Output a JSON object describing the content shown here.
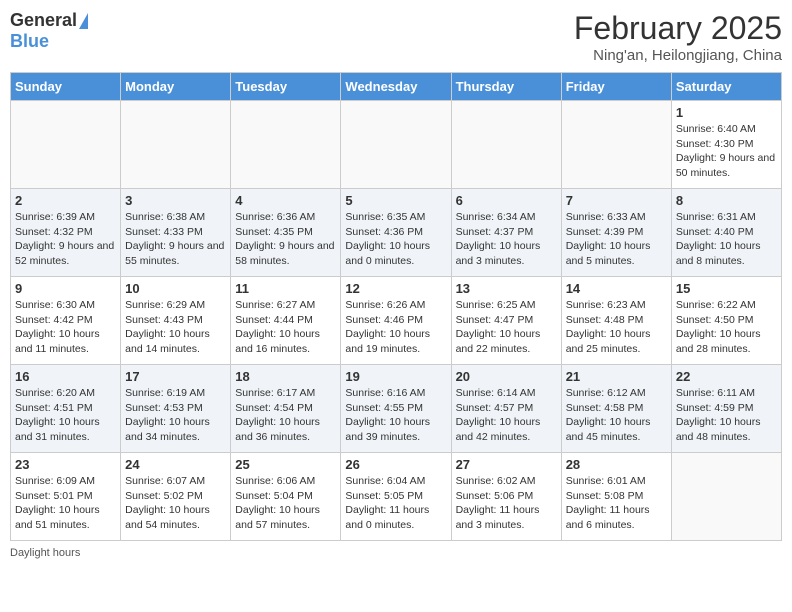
{
  "header": {
    "logo_general": "General",
    "logo_blue": "Blue",
    "month_year": "February 2025",
    "location": "Ning'an, Heilongjiang, China"
  },
  "weekdays": [
    "Sunday",
    "Monday",
    "Tuesday",
    "Wednesday",
    "Thursday",
    "Friday",
    "Saturday"
  ],
  "weeks": [
    [
      {
        "day": "",
        "info": ""
      },
      {
        "day": "",
        "info": ""
      },
      {
        "day": "",
        "info": ""
      },
      {
        "day": "",
        "info": ""
      },
      {
        "day": "",
        "info": ""
      },
      {
        "day": "",
        "info": ""
      },
      {
        "day": "1",
        "info": "Sunrise: 6:40 AM\nSunset: 4:30 PM\nDaylight: 9 hours and 50 minutes."
      }
    ],
    [
      {
        "day": "2",
        "info": "Sunrise: 6:39 AM\nSunset: 4:32 PM\nDaylight: 9 hours and 52 minutes."
      },
      {
        "day": "3",
        "info": "Sunrise: 6:38 AM\nSunset: 4:33 PM\nDaylight: 9 hours and 55 minutes."
      },
      {
        "day": "4",
        "info": "Sunrise: 6:36 AM\nSunset: 4:35 PM\nDaylight: 9 hours and 58 minutes."
      },
      {
        "day": "5",
        "info": "Sunrise: 6:35 AM\nSunset: 4:36 PM\nDaylight: 10 hours and 0 minutes."
      },
      {
        "day": "6",
        "info": "Sunrise: 6:34 AM\nSunset: 4:37 PM\nDaylight: 10 hours and 3 minutes."
      },
      {
        "day": "7",
        "info": "Sunrise: 6:33 AM\nSunset: 4:39 PM\nDaylight: 10 hours and 5 minutes."
      },
      {
        "day": "8",
        "info": "Sunrise: 6:31 AM\nSunset: 4:40 PM\nDaylight: 10 hours and 8 minutes."
      }
    ],
    [
      {
        "day": "9",
        "info": "Sunrise: 6:30 AM\nSunset: 4:42 PM\nDaylight: 10 hours and 11 minutes."
      },
      {
        "day": "10",
        "info": "Sunrise: 6:29 AM\nSunset: 4:43 PM\nDaylight: 10 hours and 14 minutes."
      },
      {
        "day": "11",
        "info": "Sunrise: 6:27 AM\nSunset: 4:44 PM\nDaylight: 10 hours and 16 minutes."
      },
      {
        "day": "12",
        "info": "Sunrise: 6:26 AM\nSunset: 4:46 PM\nDaylight: 10 hours and 19 minutes."
      },
      {
        "day": "13",
        "info": "Sunrise: 6:25 AM\nSunset: 4:47 PM\nDaylight: 10 hours and 22 minutes."
      },
      {
        "day": "14",
        "info": "Sunrise: 6:23 AM\nSunset: 4:48 PM\nDaylight: 10 hours and 25 minutes."
      },
      {
        "day": "15",
        "info": "Sunrise: 6:22 AM\nSunset: 4:50 PM\nDaylight: 10 hours and 28 minutes."
      }
    ],
    [
      {
        "day": "16",
        "info": "Sunrise: 6:20 AM\nSunset: 4:51 PM\nDaylight: 10 hours and 31 minutes."
      },
      {
        "day": "17",
        "info": "Sunrise: 6:19 AM\nSunset: 4:53 PM\nDaylight: 10 hours and 34 minutes."
      },
      {
        "day": "18",
        "info": "Sunrise: 6:17 AM\nSunset: 4:54 PM\nDaylight: 10 hours and 36 minutes."
      },
      {
        "day": "19",
        "info": "Sunrise: 6:16 AM\nSunset: 4:55 PM\nDaylight: 10 hours and 39 minutes."
      },
      {
        "day": "20",
        "info": "Sunrise: 6:14 AM\nSunset: 4:57 PM\nDaylight: 10 hours and 42 minutes."
      },
      {
        "day": "21",
        "info": "Sunrise: 6:12 AM\nSunset: 4:58 PM\nDaylight: 10 hours and 45 minutes."
      },
      {
        "day": "22",
        "info": "Sunrise: 6:11 AM\nSunset: 4:59 PM\nDaylight: 10 hours and 48 minutes."
      }
    ],
    [
      {
        "day": "23",
        "info": "Sunrise: 6:09 AM\nSunset: 5:01 PM\nDaylight: 10 hours and 51 minutes."
      },
      {
        "day": "24",
        "info": "Sunrise: 6:07 AM\nSunset: 5:02 PM\nDaylight: 10 hours and 54 minutes."
      },
      {
        "day": "25",
        "info": "Sunrise: 6:06 AM\nSunset: 5:04 PM\nDaylight: 10 hours and 57 minutes."
      },
      {
        "day": "26",
        "info": "Sunrise: 6:04 AM\nSunset: 5:05 PM\nDaylight: 11 hours and 0 minutes."
      },
      {
        "day": "27",
        "info": "Sunrise: 6:02 AM\nSunset: 5:06 PM\nDaylight: 11 hours and 3 minutes."
      },
      {
        "day": "28",
        "info": "Sunrise: 6:01 AM\nSunset: 5:08 PM\nDaylight: 11 hours and 6 minutes."
      },
      {
        "day": "",
        "info": ""
      }
    ]
  ],
  "footer": {
    "daylight_label": "Daylight hours"
  }
}
